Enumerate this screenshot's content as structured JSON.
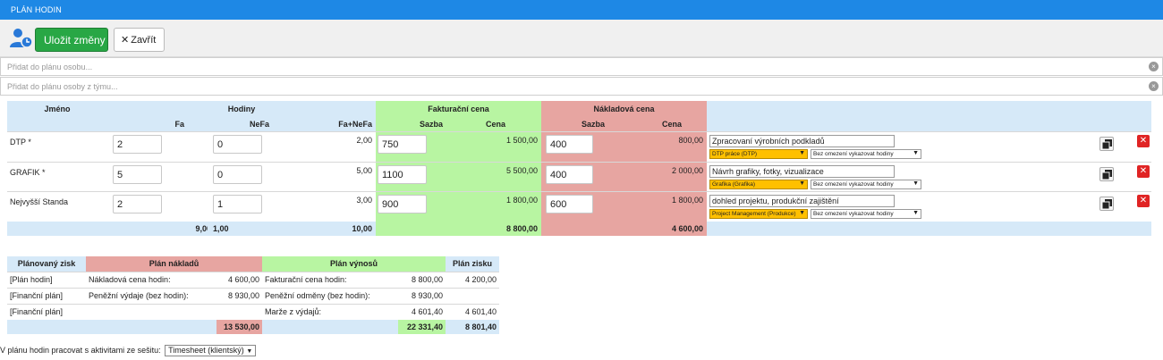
{
  "window": {
    "title": "PLÁN HODIN"
  },
  "toolbar": {
    "save_label": "Uložit změny",
    "close_icon": "✕",
    "close_label": "Zavřít"
  },
  "pickers": {
    "person_placeholder": "Přidat do plánu osobu...",
    "team_placeholder": "Přidat do plánu osoby z týmu..."
  },
  "plan": {
    "headers": {
      "name": "Jméno",
      "hours": "Hodiny",
      "invoice": "Fakturační cena",
      "cost": "Nákladová cena",
      "fa": "Fa",
      "nefa": "NeFa",
      "fanefa": "Fa+NeFa",
      "rate": "Sazba",
      "price": "Cena",
      "cost_rate": "Sazba",
      "cost_price": "Cena"
    },
    "rows": [
      {
        "name": "DTP *",
        "fa": "2",
        "nefa": "0",
        "total": "2,00",
        "rate": "750",
        "price": "1 500,00",
        "cost_rate": "400",
        "cost_price": "800,00",
        "description": "Zpracovaní výrobních podkladů",
        "activity": "DTP práce (DTP)",
        "limit": "Bez omezení vykazovat hodiny"
      },
      {
        "name": "GRAFIK *",
        "fa": "5",
        "nefa": "0",
        "total": "5,00",
        "rate": "1100",
        "price": "5 500,00",
        "cost_rate": "400",
        "cost_price": "2 000,00",
        "description": "Návrh grafiky, fotky, vizualizace",
        "activity": "Grafika (Grafika)",
        "limit": "Bez omezení vykazovat hodiny"
      },
      {
        "name": "Nejvyšší Standa",
        "fa": "2",
        "nefa": "1",
        "total": "3,00",
        "rate": "900",
        "price": "1 800,00",
        "cost_rate": "600",
        "cost_price": "1 800,00",
        "description": "dohled projektu, produkční zajištění",
        "activity": "Project Management (Produkce)",
        "limit": "Bez omezení vykazovat hodiny"
      }
    ],
    "totals": {
      "fa": "9,00",
      "nefa": "1,00",
      "fanefa": "10,00",
      "price": "8 800,00",
      "cost_price": "4 600,00"
    }
  },
  "summary": {
    "headers": {
      "profit_plan": "Plánovaný zisk",
      "cost_plan": "Plán nákladů",
      "revenue_plan": "Plán výnosů",
      "profit": "Plán zisku"
    },
    "rows": [
      {
        "source": "[Plán hodin]",
        "cost_label": "Nákladová cena hodin:",
        "cost_value": "4 600,00",
        "rev_label": "Fakturační cena hodin:",
        "rev_value": "8 800,00",
        "profit": "4 200,00"
      },
      {
        "source": "[Finanční plán]",
        "cost_label": "Peněžní výdaje (bez hodin):",
        "cost_value": "8 930,00",
        "rev_label": "Peněžní odměny (bez hodin):",
        "rev_value": "8 930,00",
        "profit": ""
      },
      {
        "source": "[Finanční plán]",
        "cost_label": "",
        "cost_value": "",
        "rev_label": "Marže z výdajů:",
        "rev_value": "4 601,40",
        "profit": "4 601,40"
      }
    ],
    "totals": {
      "cost": "13 530,00",
      "revenue": "22 331,40",
      "profit": "8 801,40"
    }
  },
  "footer": {
    "label": "V plánu hodin pracovat s aktivitami ze sešitu:",
    "workbook": "Timesheet (klientský)"
  },
  "colors": {
    "title_bar": "#1e88e5",
    "save_button": "#28a745",
    "hours_bg": "#d6e9f8",
    "invoice_bg": "#b8f5a2",
    "cost_bg": "#e7a5a1",
    "activity_bg": "#ffc000",
    "delete": "#e02424"
  }
}
